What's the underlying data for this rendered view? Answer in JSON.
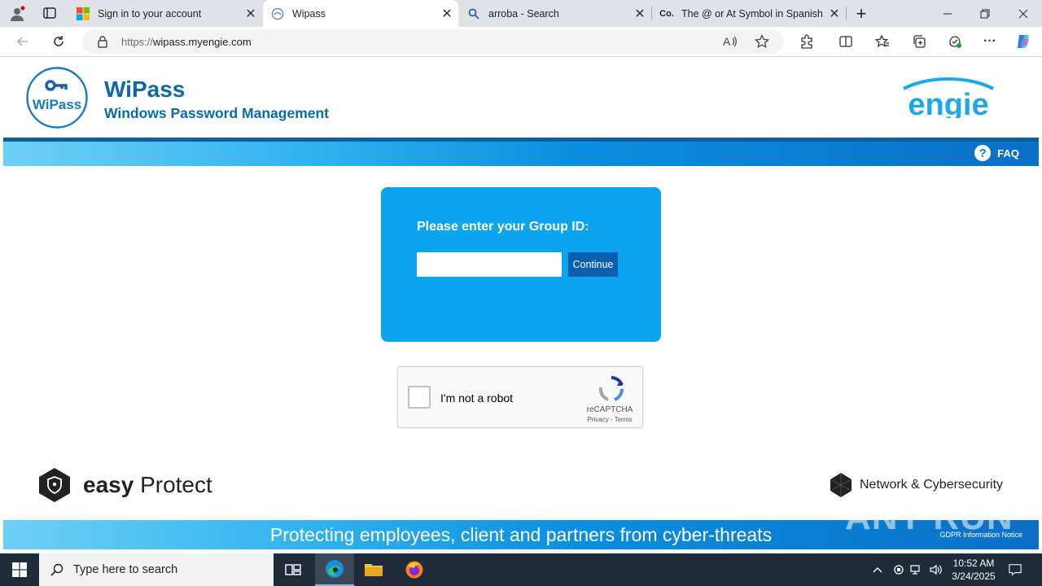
{
  "browser": {
    "tabs": [
      {
        "title": "Sign in to your account",
        "favicon": "microsoft-icon",
        "active": false
      },
      {
        "title": "Wipass",
        "favicon": "wipass-favicon",
        "active": true
      },
      {
        "title": "arroba - Search",
        "favicon": "search-icon",
        "active": false
      },
      {
        "title": "The @ or At Symbol in Spanish: M",
        "favicon": "co-icon",
        "favicon_text": "Co.",
        "active": false
      }
    ],
    "url": "https://wipass.myengie.com",
    "url_scheme": "https://",
    "url_host": "wipass.myengie.com",
    "new_tab_glyph": "+"
  },
  "page": {
    "logo_text": "WiPass",
    "title": "WiPass",
    "subtitle": "Windows Password Management",
    "brand_logo_text": "engie",
    "faq_icon": "?",
    "faq_label": "FAQ",
    "login": {
      "prompt": "Please enter your Group ID:",
      "group_id_value": "",
      "continue_label": "Continue"
    },
    "recaptcha": {
      "label": "I'm not a robot",
      "brand": "reCAPTCHA",
      "links": "Privacy - Terms"
    },
    "footer": {
      "easy_bold": "easy",
      "easy_rest": "Protect",
      "netsec": "Network & Cybersecurity",
      "slogan": "Protecting employees, client and partners from cyber-threats",
      "gdpr": "GDPR Information Notice"
    },
    "watermark": "ANY RUN",
    "colors": {
      "brand_blue": "#0a6aa8",
      "card_blue": "#0aa4ef",
      "button_blue": "#0a5fae"
    }
  },
  "taskbar": {
    "search_placeholder": "Type here to search",
    "apps": [
      "task-view-icon",
      "edge-icon",
      "file-explorer-icon",
      "firefox-icon"
    ],
    "time": "10:52 AM",
    "date": "3/24/2025"
  }
}
